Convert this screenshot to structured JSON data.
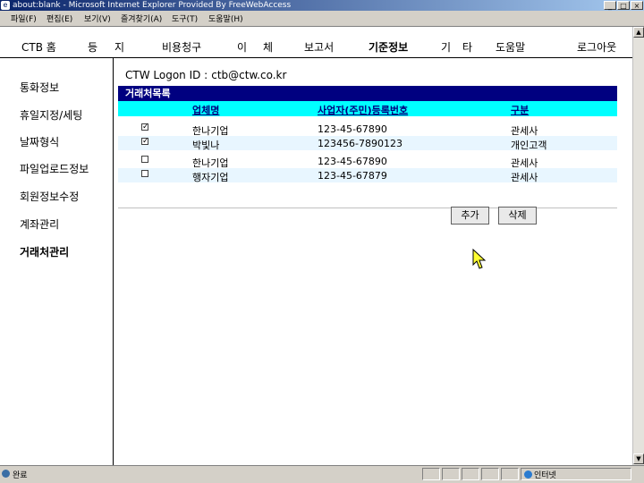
{
  "window": {
    "title": "about:blank - Microsoft Internet Explorer Provided By FreeWebAccess",
    "controls": [
      "_",
      "□",
      "×"
    ]
  },
  "menubar": {
    "items": [
      "파일(F)",
      "편집(E)",
      "보기(V)",
      "즐겨찾기(A)",
      "도구(T)",
      "도움말(H)"
    ]
  },
  "nav": {
    "items": [
      "CTB 홈",
      "등",
      "지",
      "비용청구",
      "이",
      "체",
      "보고서",
      "기준정보",
      "기",
      "타",
      "도움말",
      "로그아웃"
    ],
    "active": "기준정보"
  },
  "sidebar": {
    "items": [
      "통화정보",
      "휴일지정/세팅",
      "날짜형식",
      "파일업로드정보",
      "회원정보수정",
      "계좌관리",
      "거래처관리"
    ],
    "active": "거래처관리"
  },
  "logon": {
    "label": "CTW Logon ID :",
    "value": "ctb@ctw.co.kr"
  },
  "list": {
    "title": "거래처목록",
    "columns": [
      "업체명",
      "사업자(주민)등록번호",
      "구분"
    ],
    "rows": [
      {
        "checked": true,
        "name": "한나기업",
        "regno": "123-45-67890",
        "type": "관세사"
      },
      {
        "checked": true,
        "name": "박빛나",
        "regno": "123456-7890123",
        "type": "개인고객"
      },
      {
        "checked": false,
        "name": "한나기업",
        "regno": "123-45-67890",
        "type": "관세사"
      },
      {
        "checked": false,
        "name": "행자기업",
        "regno": "123-45-67879",
        "type": "관세사"
      }
    ]
  },
  "actions": {
    "add": "추가",
    "delete": "삭제"
  },
  "statusbar": {
    "text": "완료",
    "zone": "인터넷"
  }
}
